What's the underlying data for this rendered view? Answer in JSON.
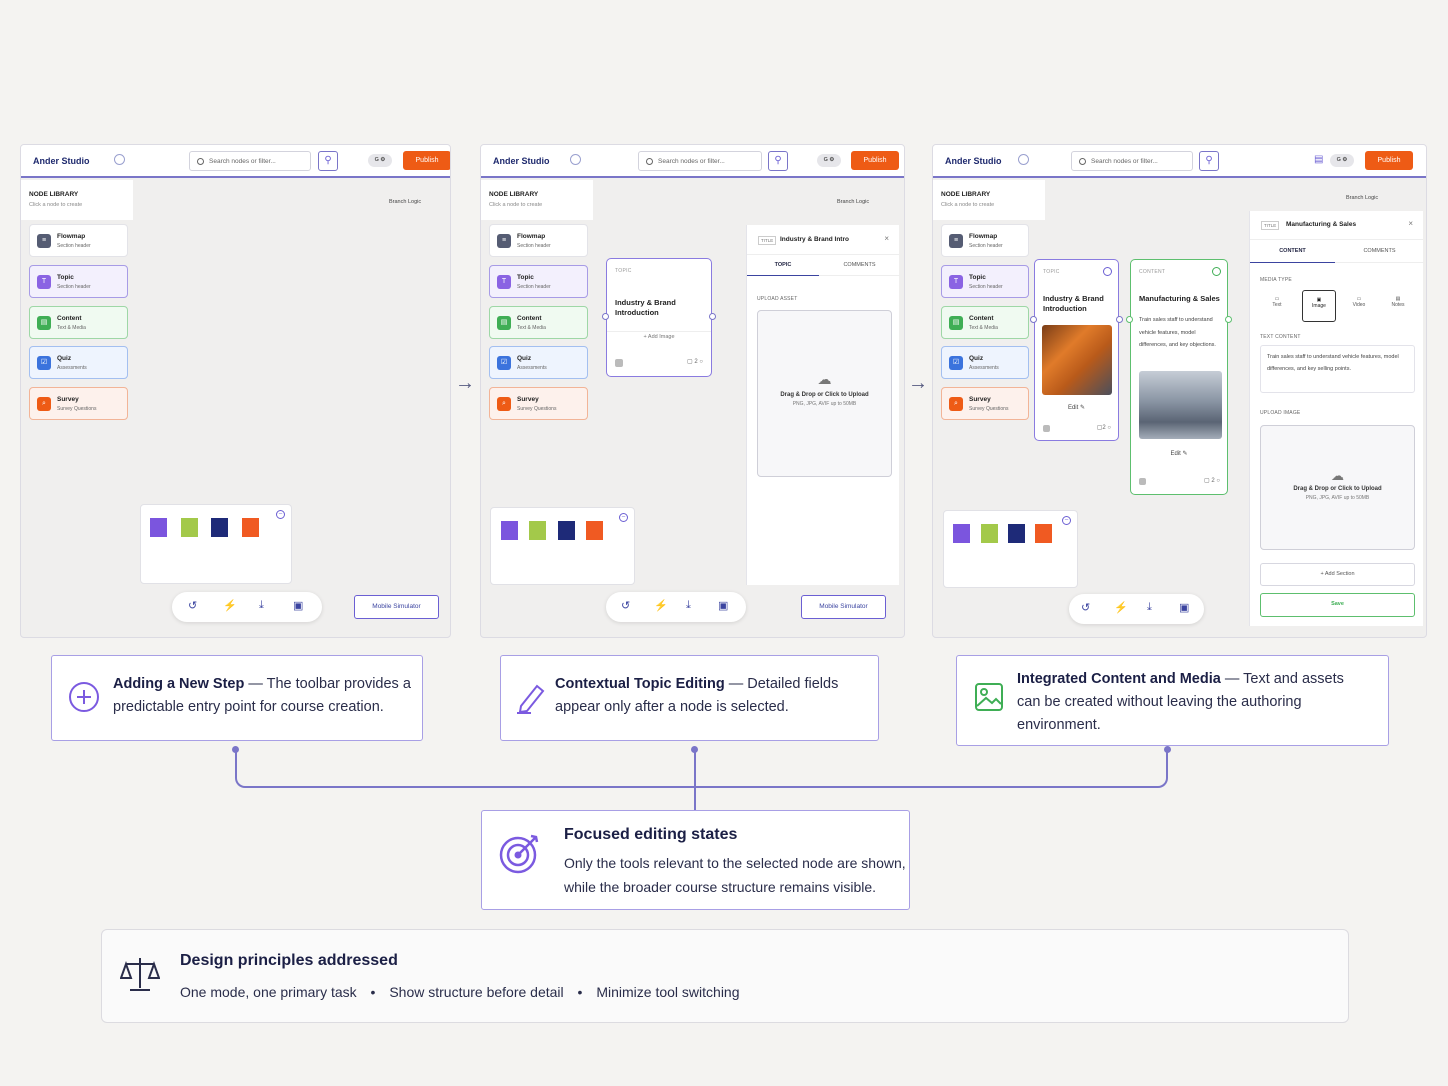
{
  "app": {
    "brand": "Ander Studio",
    "search_placeholder": "Search nodes or filter...",
    "avatars": "G  ⚙",
    "publish": "Publish",
    "branch_logic": "Branch Logic",
    "mobile_simulator": "Mobile Simulator"
  },
  "library": {
    "title": "NODE LIBRARY",
    "subtitle": "Click a node to create",
    "items": [
      {
        "label": "Flowmap",
        "sub": "Section header",
        "icon": "flowmap-icon"
      },
      {
        "label": "Topic",
        "sub": "Section header",
        "icon": "topic-icon"
      },
      {
        "label": "Content",
        "sub": "Text & Media",
        "icon": "content-icon"
      },
      {
        "label": "Quiz",
        "sub": "Assessments",
        "icon": "quiz-icon"
      },
      {
        "label": "Survey",
        "sub": "Survey Questions",
        "icon": "survey-icon"
      }
    ]
  },
  "palette_colors": [
    "#7b55de",
    "#a3c94a",
    "#1e2a78",
    "#f05a22"
  ],
  "screen2": {
    "topic_label": "TOPIC",
    "topic_title": "Industry & Brand Introduction",
    "add_image": "+ Add Image",
    "comments": "2",
    "panel_title_label": "TITLE",
    "panel_title": "Industry & Brand Intro",
    "tab_topic": "TOPIC",
    "tab_comments": "COMMENTS",
    "upload_label": "UPLOAD ASSET",
    "drop_text": "Drag & Drop or Click to Upload",
    "drop_sub": "PNG, JPG, AVIF up to 50MB"
  },
  "screen3": {
    "topic_label": "TOPIC",
    "topic_title": "Industry & Brand Introduction",
    "edit": "Edit",
    "comments": "2",
    "content_label": "CONTENT",
    "content_title": "Manufacturing & Sales",
    "content_text": "Train sales staff to understand vehicle features, model differences, and key objections.",
    "panel_title_label": "TITLE",
    "panel_title": "Manufacturing & Sales",
    "tab_content": "CONTENT",
    "tab_comments": "COMMENTS",
    "media_type_label": "MEDIA TYPE",
    "media_types": [
      "Text",
      "Image",
      "Video",
      "Notes"
    ],
    "text_content_label": "TEXT CONTENT",
    "text_content": "Train sales staff to understand vehicle features, model differences, and key selling points.",
    "upload_label": "UPLOAD IMAGE",
    "drop_text": "Drag & Drop or Click to Upload",
    "drop_sub": "PNG, JPG, AVIF up to 50MB",
    "add_section": "+ Add Section",
    "save": "Save"
  },
  "callouts": [
    {
      "title": "Adding a New Step",
      "text": " — The toolbar provides a predictable entry point for course creation."
    },
    {
      "title": "Contextual Topic Editing",
      "text": " — Detailed fields appear only after a node is selected."
    },
    {
      "title": "Integrated Content and Media",
      "text": " — Text and assets can be created without leaving the authoring environment."
    }
  ],
  "focus": {
    "title": "Focused editing states",
    "text1": "Only the tools relevant to the selected node are shown,",
    "text2": "while the broader course structure remains visible."
  },
  "principles": {
    "title": "Design principles addressed",
    "items": [
      "One mode, one primary task",
      "Show structure before detail",
      "Minimize tool switching"
    ],
    "separator": "•"
  }
}
